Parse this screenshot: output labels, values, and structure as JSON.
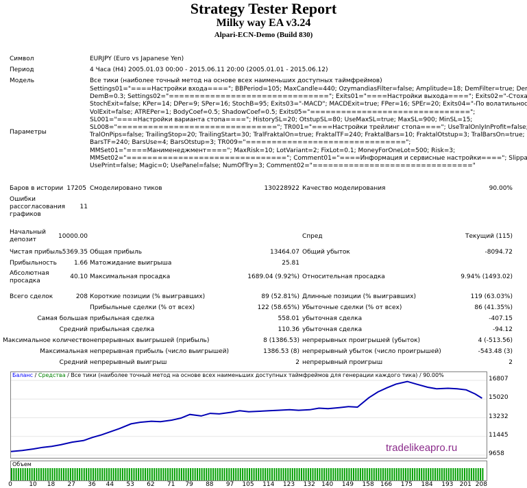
{
  "header": {
    "title": "Strategy Tester Report",
    "ea": "Milky way EA v3.24",
    "server": "Alpari-ECN-Demo (Build 830)"
  },
  "info": {
    "symbol_label": "Символ",
    "symbol_value": "EURJPY (Euro vs Japanese Yen)",
    "period_label": "Период",
    "period_value": "4 Часа (H4) 2005.01.03 00:00 - 2015.06.11 20:00 (2005.01.01 - 2015.06.12)",
    "model_label": "Модель",
    "model_value": "Все тики (наиболее точный метод на основе всех наименьших доступных таймфреймов)",
    "params_label": "Параметры",
    "params_lines": [
      "Settings01=\"====Настройки входа====\"; BBPeriod=105; MaxCandle=440; OzymandiasFilter=false; Amplitude=18; DemFilter=true; DemPer=8;",
      "DemB=0.3; Settings02=\"===============================\"; Exits01=\"====Настройки выхода====\"; Exits02=\"-Стохастик\";",
      "StochExit=false; KPer=14; DPer=9; SPer=16; StochB=95; Exits03=\"-MACD\"; MACDExit=true; FPer=16; SPEr=20; Exits04=\"-По волатильности\";",
      "VolExit=false; ATREPer=1; BodyCoef=0.5; ShadowCoef=0.5; Exits05=\"===============================\";",
      "SL001=\"====Настройки варианта стопа====\"; HistorySL=20; OtstupSL=80; UseMaxSL=true; MaxSL=900; MinSL=15;",
      "SL008=\"===============================\"; TR001=\"====Настройки трейлинг стопа====\"; UseTralOnlyInProfit=false;",
      "TralOnPips=false; TrailingStop=20; TrailingStart=30; TralFraktalOn=true; FraktalTF=240; FraktalBars=10; FraktalOtstup=3; TralBarsOn=true;",
      "BarsTF=240; BarsUse=4; BarsOtstup=3; TR009=\"===============================\";",
      "MMSet01=\"====Манименеджмент====\"; MaxRisk=10; LotVariant=2; FixLot=0.1; MoneyForOneLot=500; Risk=3;",
      "MMSet02=\"===============================\"; Comment01=\"====Информация и сервисные настройки====\"; Slippage=1;",
      "UsePrint=false; Magic=0; UsePanel=false; NumOfTry=3; Comment02=\"===============================\""
    ]
  },
  "stats": {
    "bars_label": "Баров в истории",
    "bars_value": "17205",
    "ticks_label": "Смоделировано тиков",
    "ticks_value": "130228922",
    "quality_label": "Качество моделирования",
    "quality_value": "90.00%",
    "errors_label_1": "Ошибки",
    "errors_label_2": "рассогласования",
    "errors_label_3": "графиков",
    "errors_value": "11",
    "deposit_label_1": "Начальный",
    "deposit_label_2": "депозит",
    "deposit_value": "10000.00",
    "spread_label": "Спред",
    "spread_value": "Текущий (115)",
    "net_label": "Чистая прибыль",
    "net_value": "5369.35",
    "gross_profit_label": "Общая прибыль",
    "gross_profit_value": "13464.07",
    "gross_loss_label": "Общий убыток",
    "gross_loss_value": "-8094.72",
    "pf_label": "Прибыльность",
    "pf_value": "1.66",
    "expected_label": "Матожидание выигрыша",
    "expected_value": "25.81",
    "abs_dd_label_1": "Абсолютная",
    "abs_dd_label_2": "просадка",
    "abs_dd_value": "40.10",
    "max_dd_label": "Максимальная просадка",
    "max_dd_value": "1689.04 (9.92%)",
    "rel_dd_label": "Относительная просадка",
    "rel_dd_value": "9.94% (1493.02)",
    "total_label": "Всего сделок",
    "total_value": "208",
    "short_label": "Короткие позиции (% выигравших)",
    "short_value": "89 (52.81%)",
    "long_label": "Длинные позиции (% выигравших)",
    "long_value": "119 (63.03%)",
    "profit_trades_label": "Прибыльные сделки (% от всех)",
    "profit_trades_value": "122 (58.65%)",
    "loss_trades_label": "Убыточные сделки (% от всех)",
    "loss_trades_value": "86 (41.35%)",
    "largest_label": "Самая большая",
    "largest_profit_label": "прибыльная сделка",
    "largest_profit_value": "558.01",
    "largest_loss_label": "убыточная сделка",
    "largest_loss_value": "-407.15",
    "average_label": "Средний",
    "avg_profit_label": "прибыльная сделка",
    "avg_profit_value": "110.36",
    "avg_loss_label": "убыточная сделка",
    "avg_loss_value": "-94.12",
    "max_count_label": "Максимальное количество",
    "max_cons_wins_label": "непрерывных выигрышей (прибыль)",
    "max_cons_wins_value": "8 (1386.53)",
    "max_cons_losses_label": "непрерывных проигрышей (убыток)",
    "max_cons_losses_value": "4 (-513.56)",
    "maximal_label": "Максимальная",
    "maximal_wins_label": "непрерывная прибыль (число выигрышей)",
    "maximal_wins_value": "1386.53 (8)",
    "maximal_losses_label": "непрерывный убыток (число проигрышей)",
    "maximal_losses_value": "-543.48 (3)",
    "avg_cons_label": "Средний",
    "avg_cons_wins_label": "непрерывный выигрыш",
    "avg_cons_wins_value": "2",
    "avg_cons_losses_label": "непрерывный проигрыш",
    "avg_cons_losses_value": "2"
  },
  "legend": {
    "balance": "Баланс",
    "sep1": " / ",
    "equity": "Средства",
    "rest": " / Все тики (наиболее точный метод на основе всех наименьших доступных таймфреймов для генерации каждого тика) / 90.00%"
  },
  "watermark": "tradelikeapro.ru",
  "volume_label": "Объем",
  "chart_data": {
    "type": "line",
    "title": "",
    "xlabel": "",
    "ylabel": "",
    "x_ticks": [
      "0",
      "10",
      "18",
      "27",
      "36",
      "44",
      "53",
      "62",
      "71",
      "79",
      "88",
      "97",
      "105",
      "114",
      "123",
      "132",
      "140",
      "149",
      "158",
      "166",
      "175",
      "184",
      "193",
      "201",
      "208"
    ],
    "y_ticks": [
      "16807",
      "15020",
      "13232",
      "11445",
      "9658"
    ],
    "ylim": [
      9658,
      16807
    ],
    "xlim": [
      0,
      210
    ],
    "colors": {
      "balance": "#0000b4",
      "volume": "#00a000"
    },
    "series": [
      {
        "name": "Баланс",
        "x": [
          0,
          5,
          10,
          14,
          18,
          22,
          27,
          32,
          36,
          40,
          44,
          48,
          53,
          57,
          62,
          66,
          71,
          75,
          79,
          84,
          88,
          92,
          97,
          101,
          105,
          109,
          114,
          118,
          123,
          127,
          132,
          136,
          140,
          145,
          149,
          153,
          158,
          162,
          166,
          170,
          175,
          179,
          184,
          188,
          193,
          197,
          201,
          205,
          208
        ],
        "values": [
          10000,
          10100,
          10250,
          10400,
          10500,
          10650,
          10900,
          11050,
          11350,
          11600,
          11900,
          12200,
          12650,
          12800,
          12900,
          12850,
          13000,
          13200,
          13550,
          13400,
          13650,
          13600,
          13750,
          13900,
          13800,
          13850,
          13900,
          13950,
          14000,
          13950,
          14000,
          14150,
          14100,
          14200,
          14300,
          14250,
          15150,
          15700,
          16100,
          16450,
          16700,
          16450,
          16150,
          16000,
          16050,
          16000,
          15900,
          15500,
          15100
        ]
      }
    ]
  }
}
